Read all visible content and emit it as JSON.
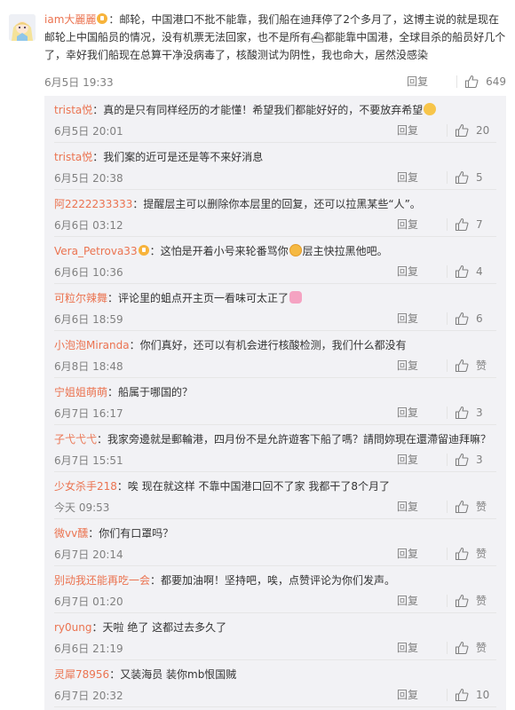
{
  "main_comment": {
    "username": "iam大麗麗",
    "text_part1": "：邮轮，中国港口不批不能靠，我们船在迪拜停了2个多月了，这博主说的就是现在邮轮上中国船员的情况，没有机票无法回家，也不是所有",
    "text_part2": "都能靠中国港，全球目杀的船员好几个了，幸好我们船现在总算干净没病毒了，核酸测试为阴性，我也命大，居然没感染",
    "time": "6月5日 19:33",
    "reply_label": "回复",
    "likes": "649"
  },
  "replies": [
    {
      "name": "trista悦",
      "text": "：真的是只有同样经历的才能懂！希望我们都能好好的，不要放弃希望",
      "time": "6月5日 20:01",
      "reply": "回复",
      "likes": "20",
      "vip": false,
      "emoji": "worry"
    },
    {
      "name": "trista悦",
      "text": "：我们案的近可是还是等不来好消息",
      "time": "6月5日 20:38",
      "reply": "回复",
      "likes": "5",
      "vip": false,
      "emoji": ""
    },
    {
      "name": "阿2222233333",
      "text": "：提醒层主可以删除你本层里的回复，还可以拉黑某些“人”。",
      "time": "6月6日 03:12",
      "reply": "回复",
      "likes": "7",
      "vip": false,
      "emoji": ""
    },
    {
      "name": "Vera_Petrova33",
      "text": "：这怕是开着小号来轮番骂你",
      "text2": "层主快拉黑他吧。",
      "time": "6月6日 10:36",
      "reply": "回复",
      "likes": "4",
      "vip": true,
      "emoji": "laugh"
    },
    {
      "name": "可粒尔辣舞",
      "text": "：评论里的蛆点开主页一看味可太正了",
      "time": "6月6日 18:59",
      "reply": "回复",
      "likes": "6",
      "vip": false,
      "emoji": "pink"
    },
    {
      "name": "小泡泡Miranda",
      "text": "：你们真好，还可以有机会进行核酸检测，我们什么都没有",
      "time": "6月8日 18:48",
      "reply": "回复",
      "likes": "赞",
      "vip": false,
      "emoji": ""
    },
    {
      "name": "宁姐姐萌萌",
      "text": "：船属于哪国的？",
      "time": "6月7日 16:17",
      "reply": "回复",
      "likes": "3",
      "vip": false,
      "emoji": ""
    },
    {
      "name": "子弋弋弋",
      "text": "：我家旁邊就是郵輪港，四月份不是允許遊客下船了嗎？請問妳現在還滯留迪拜嘛？",
      "time": "6月7日 15:51",
      "reply": "回复",
      "likes": "3",
      "vip": false,
      "emoji": ""
    },
    {
      "name": "少女杀手218",
      "text": "：唉  现在就这样  不靠中国港口回不了家  我都干了8个月了",
      "time": "今天 09:53",
      "reply": "回复",
      "likes": "赞",
      "vip": false,
      "emoji": ""
    },
    {
      "name": "微vv醺",
      "text": "：你们有口罩吗？",
      "time": "6月7日 20:14",
      "reply": "回复",
      "likes": "赞",
      "vip": false,
      "emoji": ""
    },
    {
      "name": "别动我还能再吃一会",
      "text": "：都要加油啊！坚持吧，唉，点赞评论为你们发声。",
      "time": "6月7日 01:20",
      "reply": "回复",
      "likes": "赞",
      "vip": false,
      "emoji": ""
    },
    {
      "name": "ry0ung",
      "text": "：天啦 绝了 这都过去多久了",
      "time": "6月6日 21:19",
      "reply": "回复",
      "likes": "赞",
      "vip": false,
      "emoji": ""
    },
    {
      "name": "灵犀78956",
      "text": "：又装海员  装你mb恨国贼",
      "time": "6月7日 20:32",
      "reply": "回复",
      "likes": "10",
      "vip": false,
      "emoji": ""
    }
  ],
  "colors": {
    "username": "#eb7350",
    "meta": "#808080",
    "reply_bg": "#f2f2f5"
  }
}
